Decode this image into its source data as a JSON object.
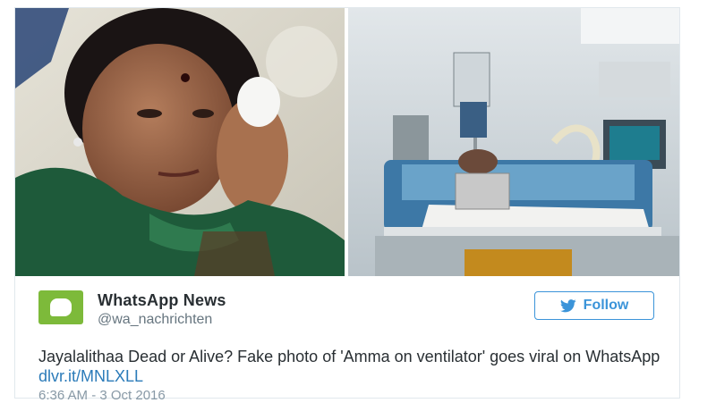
{
  "tweet": {
    "author": {
      "display_name": "WhatsApp News",
      "handle": "@wa_nachrichten",
      "avatar_icon": "whatsapp-logo-icon",
      "avatar_color": "#7dba3a"
    },
    "follow_button": {
      "label": "Follow",
      "icon": "twitter-bird-icon",
      "color": "#3b94d9"
    },
    "text": "Jayalalithaa Dead or Alive? Fake photo of 'Amma on ventilator' goes viral on WhatsApp",
    "link": "dlvr.it/MNLXLL",
    "link_color": "#2b7bb9",
    "timestamp": "6:36 AM - 3 Oct 2016",
    "media": [
      {
        "subject": "woman-in-green-saree-photo"
      },
      {
        "subject": "hospital-bed-ventilator-photo"
      }
    ]
  }
}
